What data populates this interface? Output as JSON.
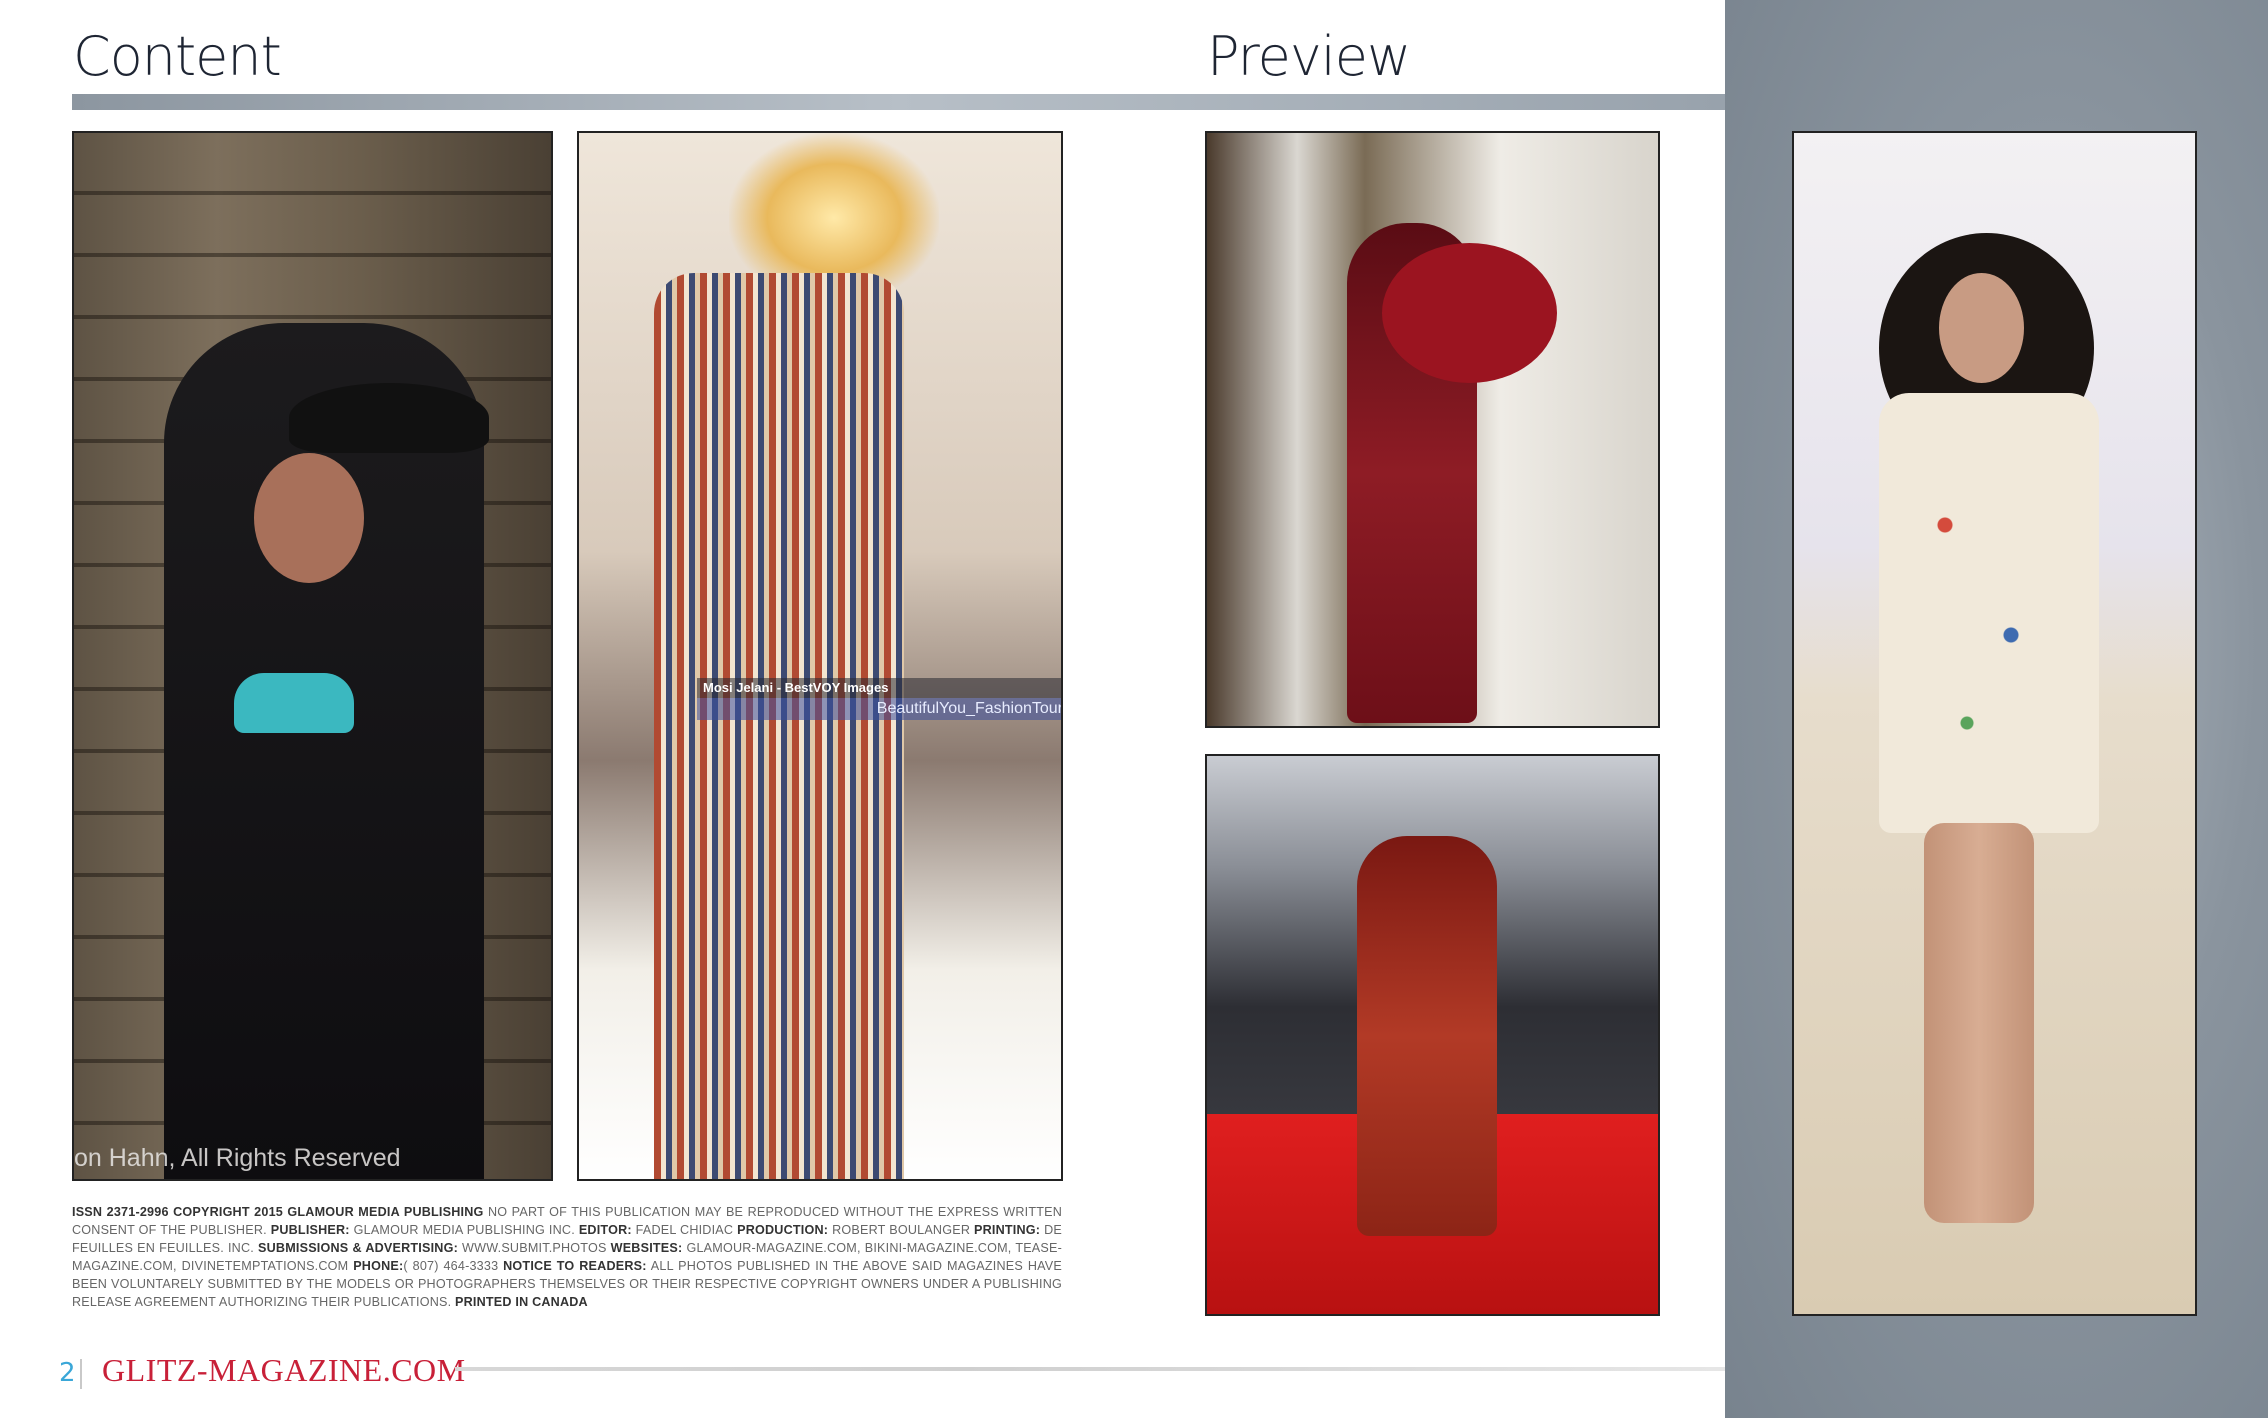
{
  "headings": {
    "content": "Content",
    "preview": "Preview"
  },
  "photos": [
    {
      "name": "photo-1",
      "credit": "on Hahn, All Rights Reserved"
    },
    {
      "name": "photo-2",
      "watermark_name": "Mosi Jelani - BestVOY Images",
      "watermark_tag": "BeautifulYou_FashionTour"
    },
    {
      "name": "photo-3"
    },
    {
      "name": "photo-4"
    },
    {
      "name": "photo-5"
    }
  ],
  "masthead": {
    "issn": "ISSN 2371-2996 COPYRIGHT 2015 GLAMOUR MEDIA PUBLISHING",
    "notice": " NO PART OF THIS PUBLICATION MAY BE REPRODUCED WITHOUT THE EXPRESS WRITTEN CONSENT OF THE PUBLISHER. ",
    "publisher_label": "PUBLISHER:",
    "publisher": " GLAMOUR MEDIA PUBLISHING INC. ",
    "editor_label": "EDITOR:",
    "editor": " FADEL CHIDIAC ",
    "production_label": "PRODUCTION:",
    "production": " ROBERT BOULANGER ",
    "printing_label": "PRINTING:",
    "printing": " DE FEUILLES EN FEUILLES. INC. ",
    "submissions_label": "SUBMISSIONS & ADVERTISING:",
    "submissions": " WWW.SUBMIT.PHOTOS ",
    "websites_label": "WEBSITES:",
    "websites": " GLAMOUR-MAGAZINE.COM, BIKINI-MAGAZINE.COM, TEASE-MAGAZINE.COM, DIVINETEMPTATIONS.COM ",
    "phone_label": "PHONE:",
    "phone": "( 807) 464-3333 ",
    "readers_label": "NOTICE TO READERS:",
    "readers": " ALL PHOTOS PUBLISHED IN THE ABOVE SAID MAGAZINES HAVE BEEN VOLUNTARELY SUBMITTED BY THE MODELS OR PHOTOGRAPHERS THEMSELVES OR THEIR RESPECTIVE COPYRIGHT OWNERS UNDER A PUBLISHING RELEASE AGREEMENT AUTHORIZING THEIR PUBLICATIONS. ",
    "printed": "PRINTED IN CANADA"
  },
  "footer": {
    "page_number": "2",
    "brand": "GLITZ-MAGAZINE.COM"
  },
  "colors": {
    "side_panel": "#7b8690",
    "page_number": "#3aa7d8",
    "brand": "#c82038"
  }
}
